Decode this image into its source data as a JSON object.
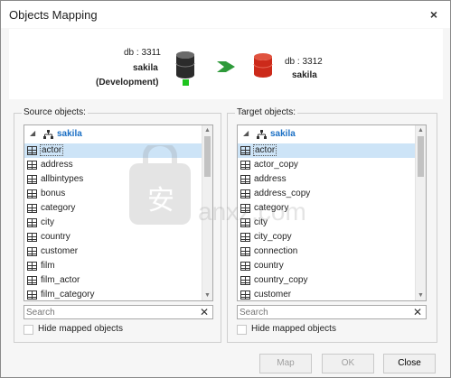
{
  "window": {
    "title": "Objects Mapping",
    "close_glyph": "×"
  },
  "source_db": {
    "db_line": "db : 3311",
    "name": "sakila",
    "env": "(Development)",
    "color": "#2b2b2b",
    "status_color": "#1fc41f"
  },
  "target_db": {
    "db_line": "db : 3312",
    "name": "sakila",
    "color": "#cc2a1a"
  },
  "arrow_color": "#2e9a3a",
  "source": {
    "group_label": "Source objects:",
    "root_arrow": "◢",
    "root": "sakila",
    "items": [
      "actor",
      "address",
      "allbintypes",
      "bonus",
      "category",
      "city",
      "country",
      "customer",
      "film",
      "film_actor",
      "film_category"
    ],
    "search_placeholder": "Search",
    "clear_glyph": "✕",
    "hide_mapped_label": "Hide mapped objects",
    "hide_mapped_checked": false
  },
  "target": {
    "group_label": "Target objects:",
    "root_arrow": "◢",
    "root": "sakila",
    "items": [
      "actor",
      "actor_copy",
      "address",
      "address_copy",
      "category",
      "city",
      "city_copy",
      "connection",
      "country",
      "country_copy",
      "customer"
    ],
    "search_placeholder": "Search",
    "clear_glyph": "✕",
    "hide_mapped_label": "Hide mapped objects",
    "hide_mapped_checked": false
  },
  "buttons": {
    "map": "Map",
    "ok": "OK",
    "close": "Close"
  },
  "watermark": {
    "brand": "anxz.com",
    "icon": "安"
  }
}
